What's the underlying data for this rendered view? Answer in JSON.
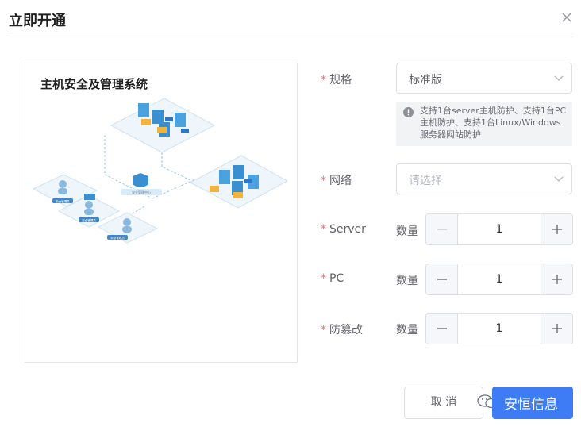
{
  "dialog": {
    "title": "立即开通",
    "close_icon": "close-icon"
  },
  "preview": {
    "title": "主机安全及管理系统",
    "diagram_labels": [
      "安全管理中心",
      "安全管理员",
      "安全管理员",
      "安全管理员"
    ]
  },
  "form": {
    "spec": {
      "label": "规格",
      "value": "标准版",
      "tip": "支持1台server主机防护、支持1台PC主机防护、支持1台Linux/Windows服务器网站防护"
    },
    "network": {
      "label": "网络",
      "placeholder": "请选择"
    },
    "server": {
      "label": "Server",
      "qty_label": "数量",
      "value": "1"
    },
    "pc": {
      "label": "PC",
      "qty_label": "数量",
      "value": "1"
    },
    "tamper": {
      "label": "防篡改",
      "qty_label": "数量",
      "value": "1"
    }
  },
  "footer": {
    "cancel_label": "取 消",
    "confirm_label": "安恒信息"
  },
  "colors": {
    "primary": "#3e7cf6",
    "required": "#f56c6c",
    "border": "#dcdfe6"
  }
}
